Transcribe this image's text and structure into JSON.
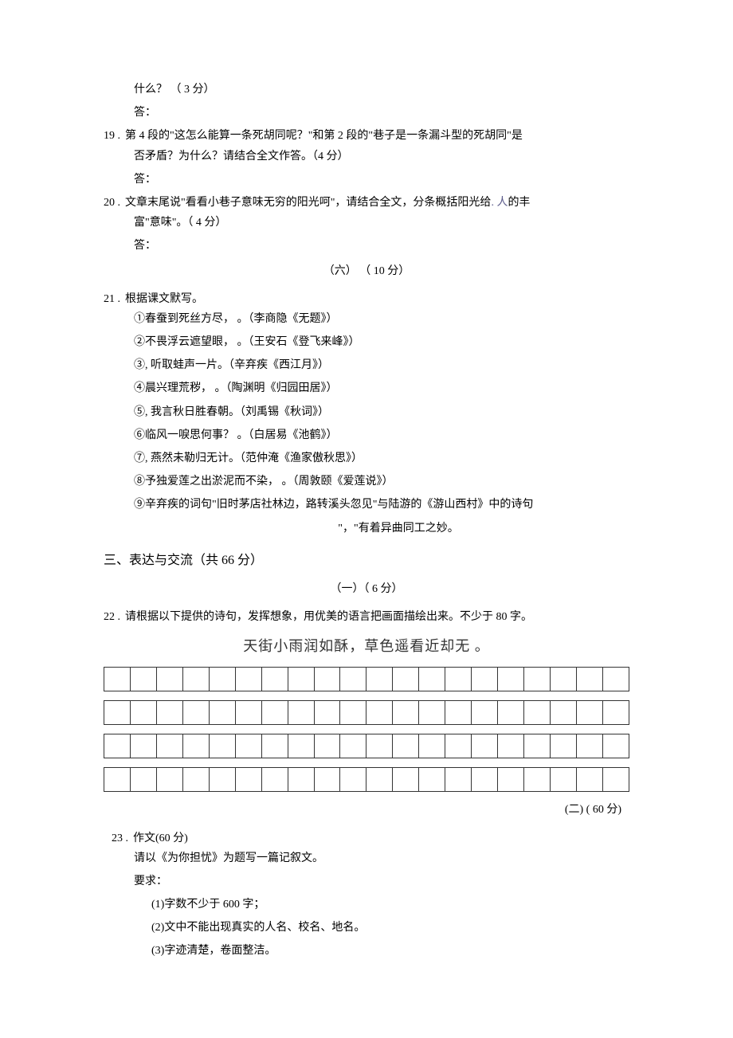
{
  "q18": {
    "frag_line1": "什么？  （ 3 分）",
    "frag_line2": "答："
  },
  "q19": {
    "num": "19 .",
    "line1": "第 4 段的\"这怎么能算一条死胡同呢？\"和第 2 段的\"巷子是一条漏斗型的死胡同\"是",
    "line2": "否矛盾？为什么？请结合全文作答。（4 分）",
    "line3": "答："
  },
  "q20": {
    "num": "20 .",
    "line1_a": "文章末尾说\"看看小巷子意味无穷的阳光呵\"，请结合全文，分条概括阳光给",
    "line1_b": ". 人",
    "line1_c": "的丰",
    "line2": "富\"意味\"。（ 4 分）",
    "line3": "答："
  },
  "sec6": {
    "label": "（六）  （ 10 分）"
  },
  "q21": {
    "num": "21 .",
    "title": "根据课文默写。",
    "items": [
      "①春蚕到死丝方尽，  。（李商隐《无题》）",
      "②不畏浮云遮望眼，  。（王安石《登飞来峰》）",
      "③, 听取蛙声一片。（辛弃疾《西江月》）",
      "④晨兴理荒秽，  。（陶渊明《归园田居》）",
      "⑤, 我言秋日胜春朝。（刘禹锡《秋词》）",
      "⑥临风一唳思何事？  。（白居易《池鹤》）",
      "⑦, 燕然未勒归无计。（范仲淹《渔家傲秋思》）",
      "⑧予独爱莲之出淤泥而不染，  。（周敦颐《爱莲说》）",
      "⑨辛弃疾的词句\"旧时茅店社林边，路转溪头忽见\"与陆游的《游山西村》中的诗句"
    ],
    "tail": "\"，\"有着异曲同工之妙。"
  },
  "sec3": {
    "title": "三、表达与交流（共 66 分）",
    "sub1": "（一）（ 6 分）",
    "sub2": "(二) ( 60 分)"
  },
  "q22": {
    "num": "22 .",
    "text": "请根据以下提供的诗句，发挥想象，用优美的语言把画面描绘出来。不少于 80 字。",
    "poem": "天街小雨润如酥，草色遥看近却无  。"
  },
  "q23": {
    "num": "23 .",
    "title": "作文(60 分)",
    "line1": "请以《为你担忧》为题写一篇记叙文。",
    "line2": "要求：",
    "r1": "(1)字数不少于 600 字；",
    "r2": "(2)文中不能出现真实的人名、校名、地名。",
    "r3": "(3)字迹清楚，卷面整洁。"
  },
  "grid": {
    "rows": 4,
    "cols": 20
  }
}
